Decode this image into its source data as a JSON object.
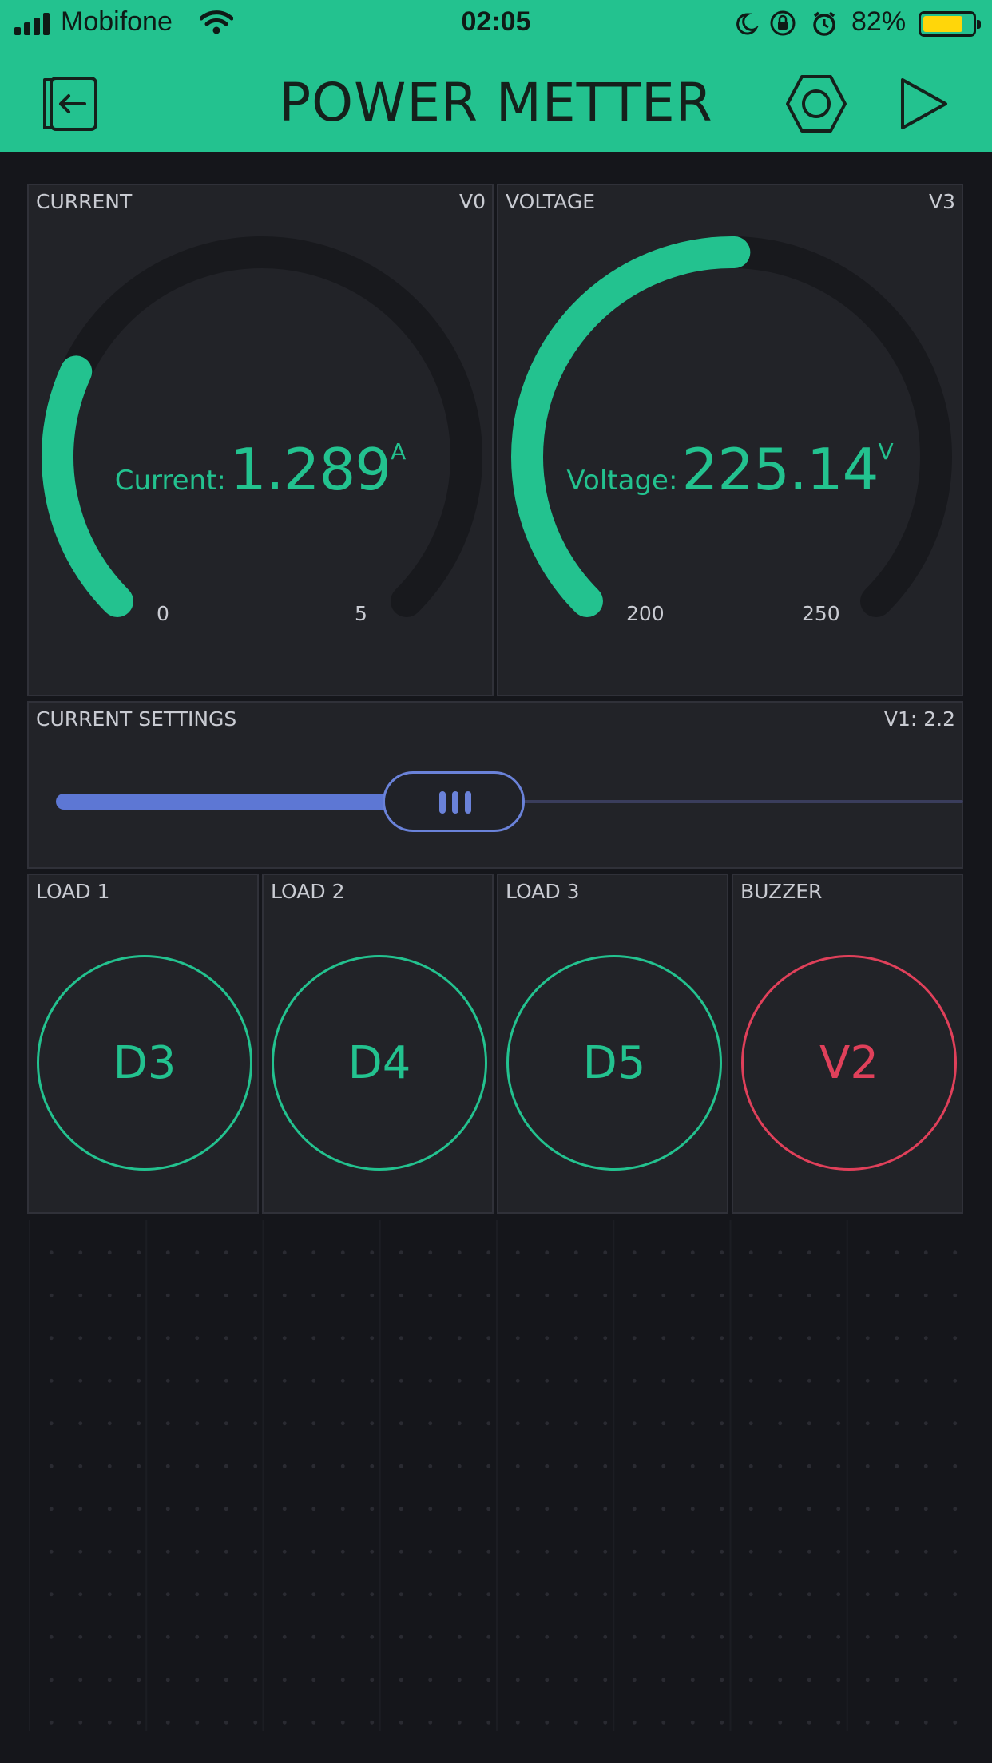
{
  "status_bar": {
    "carrier": "Mobifone",
    "time": "02:05",
    "battery_percent": "82%",
    "battery_level": 0.82
  },
  "app_bar": {
    "title": "POWER METTER"
  },
  "gauges": [
    {
      "label": "CURRENT",
      "pin": "V0",
      "caption": "Current:",
      "value": "1.289",
      "unit": "A",
      "min": "0",
      "max": "5",
      "numeric": 1.289,
      "range": [
        0,
        5
      ]
    },
    {
      "label": "VOLTAGE",
      "pin": "V3",
      "caption": "Voltage:",
      "value": "225.14",
      "unit": "V",
      "min": "200",
      "max": "250",
      "numeric": 225.14,
      "range": [
        200,
        250
      ]
    }
  ],
  "slider": {
    "label": "CURRENT SETTINGS",
    "pin_value": "V1: 2.2",
    "level": 0.44
  },
  "buttons": [
    {
      "label": "LOAD 1",
      "pin": "D3",
      "color": "#23c28f"
    },
    {
      "label": "LOAD 2",
      "pin": "D4",
      "color": "#23c28f"
    },
    {
      "label": "LOAD 3",
      "pin": "D5",
      "color": "#23c28f"
    },
    {
      "label": "BUZZER",
      "pin": "V2",
      "color": "#e0405a"
    }
  ],
  "colors": {
    "accent": "#23c28f",
    "slider": "#5d77d4",
    "alert": "#e0405a",
    "background": "#15161b",
    "widget": "#222328"
  }
}
